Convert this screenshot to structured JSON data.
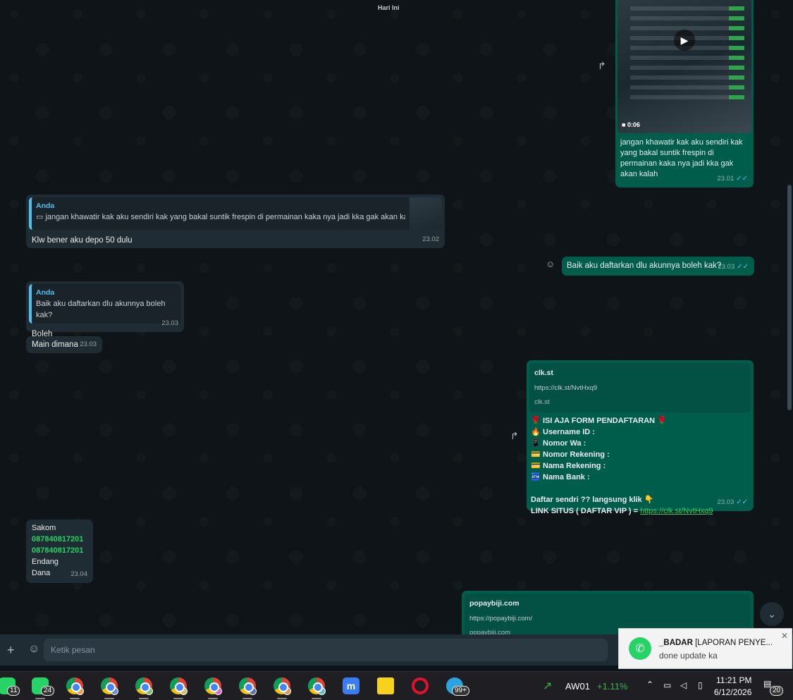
{
  "chat": {
    "date_label": "Hari Ini",
    "video_message": {
      "duration": "0:06",
      "caption": [
        "jangan khawatir kak aku sendiri kak",
        "yang bakal suntik frespin di",
        "permainan kaka nya jadi kka gak",
        "akan kalah"
      ],
      "time": "23.01"
    },
    "reply_msg_1": {
      "quote_author": "Anda",
      "quote_text": "jangan khawatir kak aku sendiri kak yang bakal suntik frespin di permainan kaka nya jadi kka gak akan kalah",
      "text": "Klw bener aku depo 50 dulu",
      "time": "23.02"
    },
    "out_msg_1": {
      "text": "Baik aku daftarkan dlu akunnya boleh kak?",
      "time": "23.03"
    },
    "reply_msg_2": {
      "quote_author": "Anda",
      "quote_text": "Baik aku daftarkan dlu akunnya boleh kak?",
      "text": "Boleh",
      "time": "23.03"
    },
    "in_msg_main": {
      "text": "Main dimana",
      "time": "23.03"
    },
    "form_msg": {
      "link_title": "clk.st",
      "link_url": "https://clk.st/NvtHxq9",
      "link_domain": "clk.st",
      "lines": [
        {
          "emoji": "🌹",
          "text": "ISI AJA FORM PENDAFTARAN",
          "trail": "🌹"
        },
        {
          "emoji": "🔥",
          "text": "Username ID :"
        },
        {
          "emoji": "📱",
          "text": "Nomor Wa :"
        },
        {
          "emoji": "💳",
          "text": "Nomor Rekening :"
        },
        {
          "emoji": "💳",
          "text": "Nama Rekening :"
        },
        {
          "emoji": "🏧",
          "text": "Nama Bank :"
        }
      ],
      "cta": "Daftar sendri ?? langsung klik 👇",
      "link_label": "LINK SITUS ( DAFTAR VIP )  =",
      "link_text": "https://clk.st/NvtHxq9",
      "time": "23.03"
    },
    "bank_msg": {
      "line1": "Sakom",
      "phone1": "087840817201",
      "phone2": "087840817201",
      "line4": "Endang",
      "line5": "Dana",
      "time": "23.04"
    },
    "last_link": {
      "title": "popaybiji.com",
      "url": "https://popaybiji.com/",
      "domain": "popaybiji.com"
    }
  },
  "composer": {
    "placeholder": "Ketik pesan"
  },
  "toast": {
    "sender": "_BADAR",
    "title_rest": " [LAPORAN PENYE...",
    "body": "done update ka"
  },
  "taskbar": {
    "badges": {
      "wa1": "11",
      "wa2": "24",
      "telegram": "99+",
      "notifications": "20"
    },
    "stock_name": "AW01",
    "stock_change": "+1.11%",
    "time": "11:21 PM",
    "date": "6/12/2026"
  },
  "colors": {
    "outgoing": "#005c4b",
    "incoming": "#202c33",
    "accent": "#25d366",
    "link": "#53bdeb"
  }
}
